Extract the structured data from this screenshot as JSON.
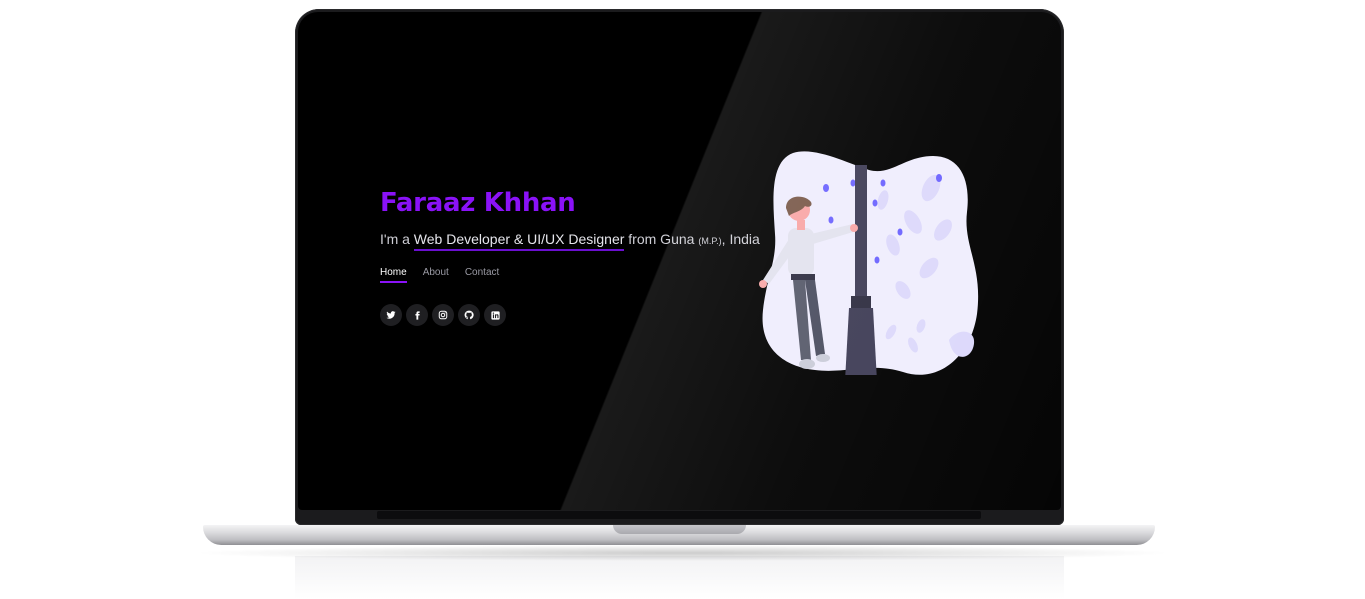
{
  "hero": {
    "name": "Faraaz Khhan",
    "intro_prefix": "I'm a ",
    "intro_role": "Web Developer & UI/UX Designer",
    "intro_from": " from Guna ",
    "intro_region": "(M.P.)",
    "intro_suffix": ", India"
  },
  "nav": {
    "items": [
      {
        "label": "Home",
        "active": true
      },
      {
        "label": "About",
        "active": false
      },
      {
        "label": "Contact",
        "active": false
      }
    ]
  },
  "socials": [
    "twitter-icon",
    "facebook-icon",
    "instagram-icon",
    "github-icon",
    "linkedin-icon"
  ],
  "colors": {
    "accent": "#8a12f7",
    "screen_bg": "#000000",
    "illustration_blob": "#efedfd",
    "illustration_pole": "#3f3d56"
  }
}
